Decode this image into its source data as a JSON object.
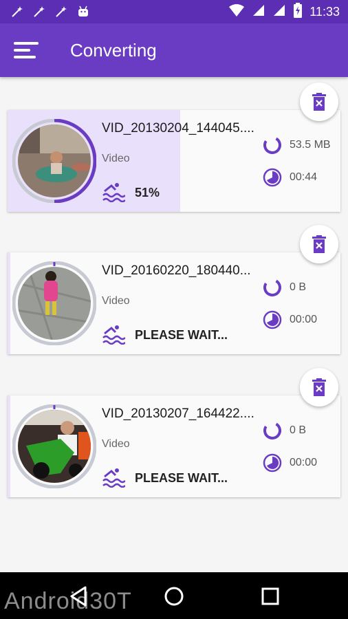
{
  "status_bar": {
    "time": "11:33",
    "left_icons": [
      "magic-wand-icon",
      "magic-wand-icon",
      "magic-wand-icon",
      "android-icon"
    ],
    "right_icons": [
      "wifi-icon",
      "cell-signal-icon",
      "cell-signal-icon",
      "battery-charging-icon"
    ]
  },
  "app_bar": {
    "title": "Converting"
  },
  "colors": {
    "primary": "#6a3cc3",
    "primary_dark": "#5c2eb3",
    "accent": "#6a3cc3",
    "progress_fill": "#e9e0fb"
  },
  "items": [
    {
      "name": "VID_20130204_144045....",
      "type": "Video",
      "status": "51%",
      "progress": 0.51,
      "size": "53.5 MB",
      "duration": "00:44"
    },
    {
      "name": "VID_20160220_180440...",
      "type": "Video",
      "status": "PLEASE WAIT...",
      "progress": 0,
      "size": "0 B",
      "duration": "00:00"
    },
    {
      "name": "VID_20130207_164422....",
      "type": "Video",
      "status": "PLEASE WAIT...",
      "progress": 0,
      "size": "0 B",
      "duration": "00:00"
    }
  ],
  "nav_bar": {
    "buttons": [
      "back-icon",
      "home-icon",
      "recents-icon"
    ]
  },
  "watermark": {
    "text": "Android30T"
  }
}
